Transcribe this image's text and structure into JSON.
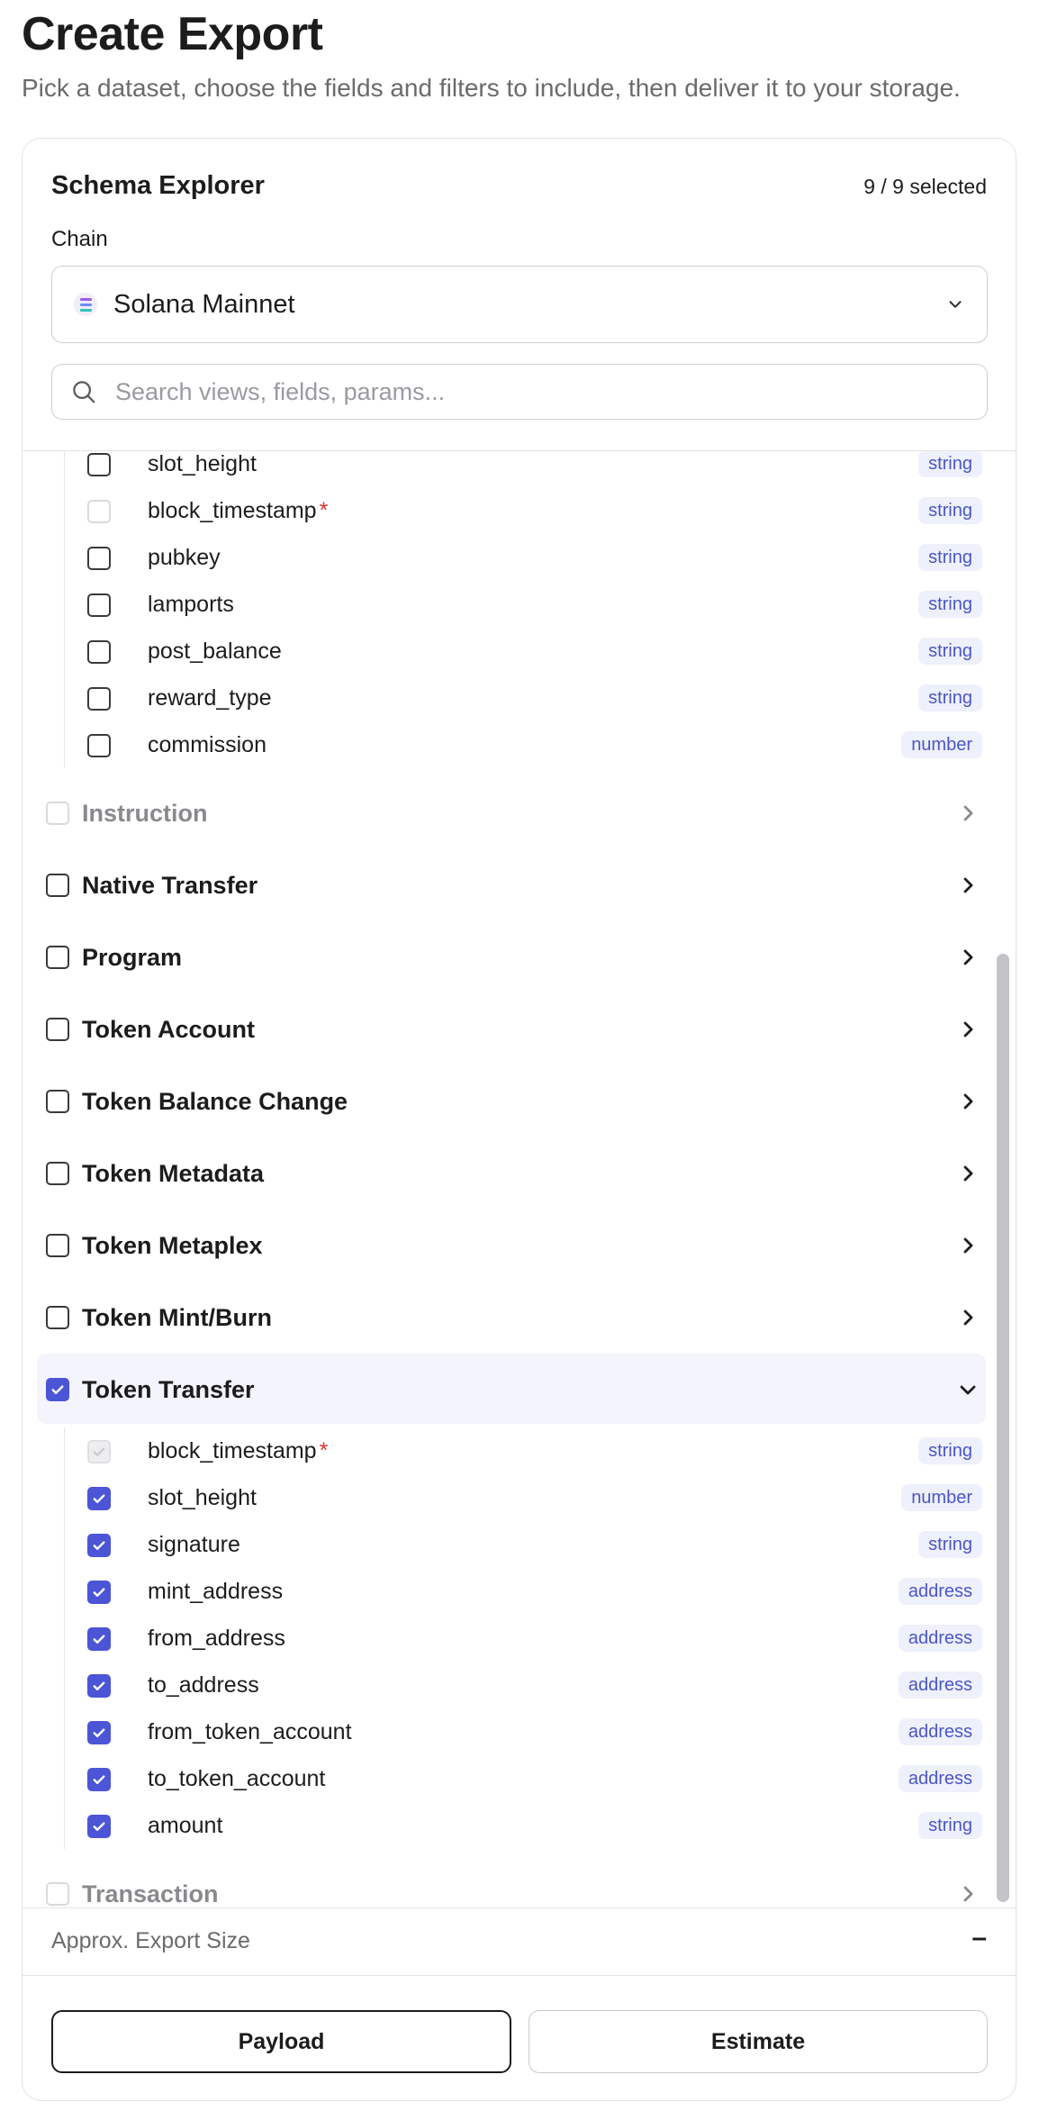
{
  "page": {
    "title": "Create Export",
    "subtitle": "Pick a dataset, choose the fields and filters to include, then deliver it to your storage."
  },
  "explorer": {
    "title": "Schema Explorer",
    "selected_count": "9 / 9 selected",
    "chain_label": "Chain",
    "chain_value": "Solana Mainnet",
    "chain_icon": "solana-logo-icon",
    "search_placeholder": "Search views, fields, params..."
  },
  "reward_fields": [
    {
      "name": "slot_height",
      "type": "string",
      "required": false,
      "checked": false,
      "disabled": false
    },
    {
      "name": "block_timestamp",
      "type": "string",
      "required": true,
      "checked": false,
      "disabled": true
    },
    {
      "name": "pubkey",
      "type": "string",
      "required": false,
      "checked": false,
      "disabled": false
    },
    {
      "name": "lamports",
      "type": "string",
      "required": false,
      "checked": false,
      "disabled": false
    },
    {
      "name": "post_balance",
      "type": "string",
      "required": false,
      "checked": false,
      "disabled": false
    },
    {
      "name": "reward_type",
      "type": "string",
      "required": false,
      "checked": false,
      "disabled": false
    },
    {
      "name": "commission",
      "type": "number",
      "required": false,
      "checked": false,
      "disabled": false
    }
  ],
  "views_before": [
    {
      "name": "Instruction",
      "checked": false,
      "disabled": true
    },
    {
      "name": "Native Transfer",
      "checked": false,
      "disabled": false
    },
    {
      "name": "Program",
      "checked": false,
      "disabled": false
    },
    {
      "name": "Token Account",
      "checked": false,
      "disabled": false
    },
    {
      "name": "Token Balance Change",
      "checked": false,
      "disabled": false
    },
    {
      "name": "Token Metadata",
      "checked": false,
      "disabled": false
    },
    {
      "name": "Token Metaplex",
      "checked": false,
      "disabled": false
    },
    {
      "name": "Token Mint/Burn",
      "checked": false,
      "disabled": false
    }
  ],
  "expanded_view": {
    "name": "Token Transfer",
    "checked": true,
    "fields": [
      {
        "name": "block_timestamp",
        "type": "string",
        "required": true,
        "checked": true,
        "disabled": true
      },
      {
        "name": "slot_height",
        "type": "number",
        "required": false,
        "checked": true,
        "disabled": false
      },
      {
        "name": "signature",
        "type": "string",
        "required": false,
        "checked": true,
        "disabled": false
      },
      {
        "name": "mint_address",
        "type": "address",
        "required": false,
        "checked": true,
        "disabled": false
      },
      {
        "name": "from_address",
        "type": "address",
        "required": false,
        "checked": true,
        "disabled": false
      },
      {
        "name": "to_address",
        "type": "address",
        "required": false,
        "checked": true,
        "disabled": false
      },
      {
        "name": "from_token_account",
        "type": "address",
        "required": false,
        "checked": true,
        "disabled": false
      },
      {
        "name": "to_token_account",
        "type": "address",
        "required": false,
        "checked": true,
        "disabled": false
      },
      {
        "name": "amount",
        "type": "string",
        "required": false,
        "checked": true,
        "disabled": false
      }
    ]
  },
  "views_after": [
    {
      "name": "Transaction",
      "checked": false,
      "disabled": true
    }
  ],
  "export_size": {
    "label": "Approx. Export Size",
    "value": "–"
  },
  "actions": {
    "payload_label": "Payload",
    "estimate_label": "Estimate"
  },
  "colors": {
    "accent": "#4c55d6",
    "badge_bg": "#eef0fb",
    "badge_text": "#4a56c6",
    "required": "#d8332f"
  }
}
